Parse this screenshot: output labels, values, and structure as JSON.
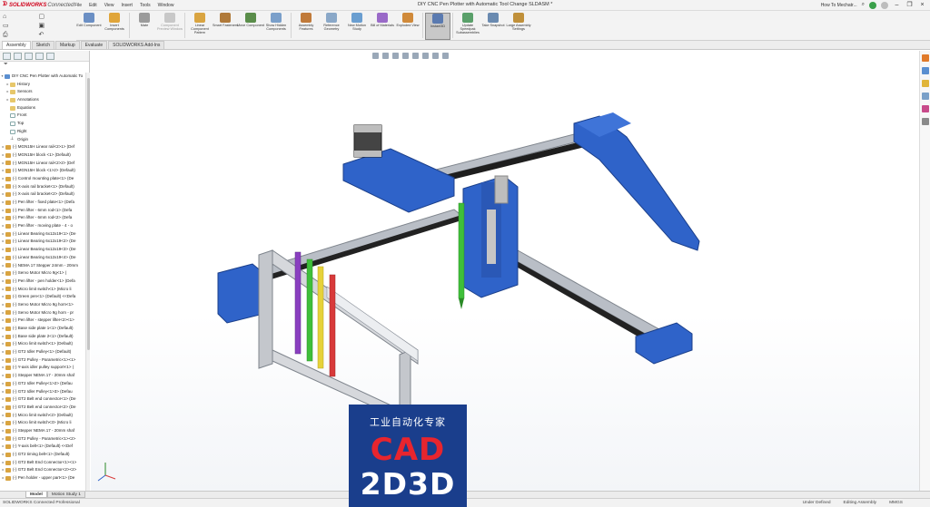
{
  "app": {
    "brand_name": "SOLIDWORKS",
    "brand_suffix": "Connected",
    "document_title": "DIY CNC Pen Plotter with Automatic Tool Change SLDASM *",
    "search_label": "How To Mechatr...",
    "menus": [
      "File",
      "Edit",
      "View",
      "Insert",
      "Tools",
      "Window"
    ]
  },
  "ribbon": {
    "buttons": [
      {
        "label": "Edit Component",
        "icon": "edit-component-icon",
        "color": "#6b8fc4",
        "enabled": true
      },
      {
        "label": "Insert Components",
        "icon": "insert-components-icon",
        "color": "#e0a53a",
        "enabled": true
      },
      {
        "label": "Mate",
        "icon": "mate-icon",
        "color": "#9b9b9b",
        "enabled": true
      },
      {
        "label": "Component Preview Window",
        "icon": "preview-window-icon",
        "color": "#c8c8c8",
        "enabled": false
      },
      {
        "label": "Linear Component Pattern",
        "icon": "linear-pattern-icon",
        "color": "#d9a441",
        "enabled": true
      },
      {
        "label": "Smart Fasteners",
        "icon": "smart-fasteners-icon",
        "color": "#b07a3a",
        "enabled": true
      },
      {
        "label": "Move Component",
        "icon": "move-component-icon",
        "color": "#5a8d4a",
        "enabled": true
      },
      {
        "label": "Show Hidden Components",
        "icon": "show-hidden-icon",
        "color": "#7a9fca",
        "enabled": true
      },
      {
        "label": "Assembly Features",
        "icon": "assembly-features-icon",
        "color": "#c07a3a",
        "enabled": true
      },
      {
        "label": "Reference Geometry",
        "icon": "reference-geometry-icon",
        "color": "#8aa8c8",
        "enabled": true
      },
      {
        "label": "New Motion Study",
        "icon": "motion-study-icon",
        "color": "#6a9ed0",
        "enabled": true
      },
      {
        "label": "Bill of Materials",
        "icon": "bill-of-materials-icon",
        "color": "#9a6ac8",
        "enabled": true
      },
      {
        "label": "Exploded View",
        "icon": "exploded-view-icon",
        "color": "#d08a3a",
        "enabled": true
      },
      {
        "label": "Instant3D",
        "icon": "instant3d-icon",
        "color": "#5a7ab0",
        "enabled": true,
        "selected": true
      },
      {
        "label": "Update Speedpak Subassemblies",
        "icon": "speedpak-icon",
        "color": "#5aa06a",
        "enabled": true
      },
      {
        "label": "Take Snapshot",
        "icon": "snapshot-icon",
        "color": "#6a8ab0",
        "enabled": true
      },
      {
        "label": "Large Assembly Settings",
        "icon": "large-assembly-icon",
        "color": "#c0903a",
        "enabled": true
      }
    ]
  },
  "command_tabs": [
    "Assembly",
    "Sketch",
    "Markup",
    "Evaluate",
    "SOLIDWORKS Add-Ins"
  ],
  "feature_tree": {
    "root": "DIY CNC Pen Plotter with Automatic To",
    "items": [
      {
        "label": "History",
        "type": "fold",
        "indent": 1
      },
      {
        "label": "Sensors",
        "type": "fold",
        "indent": 1
      },
      {
        "label": "Annotations",
        "type": "fold",
        "indent": 1
      },
      {
        "label": "Equations",
        "type": "fold",
        "indent": 1
      },
      {
        "label": "Front",
        "type": "plane",
        "indent": 1
      },
      {
        "label": "Top",
        "type": "plane",
        "indent": 1
      },
      {
        "label": "Right",
        "type": "plane",
        "indent": 1
      },
      {
        "label": "Origin",
        "type": "origin",
        "indent": 1
      },
      {
        "label": "(-) MGN15H Linear rail<2>1> (Def",
        "type": "gear",
        "indent": 0
      },
      {
        "label": "(-) MGN15H block <1> (Default)",
        "type": "gear",
        "indent": 0
      },
      {
        "label": "(-) MGN15H Linear rail<2>2> (Def",
        "type": "gear",
        "indent": 0
      },
      {
        "label": "(-) MGN15H block <1>2> (Default)",
        "type": "gear",
        "indent": 0
      },
      {
        "label": "(-) Control mounting plate<1> (De",
        "type": "gear",
        "indent": 0
      },
      {
        "label": "(-) X-axis rail bracket<1> (Default)",
        "type": "gear",
        "indent": 0
      },
      {
        "label": "(-) X-axis rail bracket<2> (Default)",
        "type": "gear",
        "indent": 0
      },
      {
        "label": "(-) Pen lifter - fixed plate<1> (Defa",
        "type": "gear",
        "indent": 0
      },
      {
        "label": "(-) Pen lifter - 6mm rod<1> (Defa",
        "type": "gear",
        "indent": 0
      },
      {
        "label": "(-) Pen lifter - 6mm rod<2> (Defa",
        "type": "gear",
        "indent": 0
      },
      {
        "label": "(-) Pen lifter - moving plate - 4 - o",
        "type": "gear",
        "indent": 0
      },
      {
        "label": "(-) Linear Bearing 6x12x19<1> (De",
        "type": "gear",
        "indent": 0
      },
      {
        "label": "(-) Linear Bearing 6x12x19<2> (De",
        "type": "gear",
        "indent": 0
      },
      {
        "label": "(-) Linear Bearing 6x12x19<3> (De",
        "type": "gear",
        "indent": 0
      },
      {
        "label": "(-) Linear Bearing 6x12x19<4> (De",
        "type": "gear",
        "indent": 0
      },
      {
        "label": "(-) NEMA 17 Stepper 24mm - 20mm",
        "type": "gear",
        "indent": 0
      },
      {
        "label": "(-) Servo Motor Micro 9g<1> (",
        "type": "gear",
        "indent": 0
      },
      {
        "label": "(-) Pen lifter - pen holder<1> (Defa",
        "type": "gear",
        "indent": 0
      },
      {
        "label": "(-) Micro limit switch<1> (Micro li",
        "type": "gear",
        "indent": 0
      },
      {
        "label": "(-) Green pen<1> (Default) <<Defa",
        "type": "gear",
        "indent": 0
      },
      {
        "label": "(-) Servo Motor Micro 9g horn<1>",
        "type": "gear",
        "indent": 0
      },
      {
        "label": "(-) Servo Motor Micro 9g horn - pr",
        "type": "gear",
        "indent": 0
      },
      {
        "label": "(-) Pen lifter - stepper lifter<2><1>",
        "type": "gear",
        "indent": 0
      },
      {
        "label": "(-) Base side plate 1<1> (Default)",
        "type": "gear",
        "indent": 0
      },
      {
        "label": "(-) Base side plate 2<1> (Default)",
        "type": "gear",
        "indent": 0
      },
      {
        "label": "(-) Micro limit switch<1> (Default)",
        "type": "gear",
        "indent": 0
      },
      {
        "label": "(-) GT2 Idler Pulley<1> (Default)",
        "type": "gear",
        "indent": 0
      },
      {
        "label": "(-) GT2 Pulley - Parametric<1><1>",
        "type": "gear",
        "indent": 0
      },
      {
        "label": "(-) Y-axis idler pulley support<1> (",
        "type": "gear",
        "indent": 0
      },
      {
        "label": "(-) Stepper NEMA 17 - 20mm shaf",
        "type": "gear",
        "indent": 0
      },
      {
        "label": "(-) GT2 Idler Pulley<1>2> (Defau",
        "type": "gear",
        "indent": 0
      },
      {
        "label": "(-) GT2 Idler Pulley<1>3> (Defau",
        "type": "gear",
        "indent": 0
      },
      {
        "label": "(-) GT2 Belt end connector<1> (De",
        "type": "gear",
        "indent": 0
      },
      {
        "label": "(-) GT2 Belt end connector<2> (De",
        "type": "gear",
        "indent": 0
      },
      {
        "label": "(-) Micro limit switch<2> (Default)",
        "type": "gear",
        "indent": 0
      },
      {
        "label": "(-) Micro limit switch<3> (Micro li",
        "type": "gear",
        "indent": 0
      },
      {
        "label": "(-) Stepper NEMA 17 - 20mm shaf",
        "type": "gear",
        "indent": 0
      },
      {
        "label": "(-) GT2 Pulley - Parametric<1><2>",
        "type": "gear",
        "indent": 0
      },
      {
        "label": "(-) Y-axis belt<1> (Default) <<Def",
        "type": "gear",
        "indent": 0
      },
      {
        "label": "(-) GT2 timing belt<1> (Default)",
        "type": "gear",
        "indent": 0
      },
      {
        "label": "(-) GT2 Belt End Connector<1><1>",
        "type": "gear",
        "indent": 0
      },
      {
        "label": "(-) GT2 Belt End Connector<2><2>",
        "type": "gear",
        "indent": 0
      },
      {
        "label": "(-) Pen holder - upper part<1> (De",
        "type": "gear",
        "indent": 0
      }
    ]
  },
  "bottom_tabs": [
    "Model",
    "Motion Study 1"
  ],
  "status": {
    "left": "SOLIDWORKS Connected Professional",
    "under_defined": "Under Defined",
    "editing": "Editing Assembly",
    "units": "MMGS"
  },
  "watermark": {
    "line1": "工业自动化专家",
    "line2": "CAD",
    "line3": "2D3D"
  },
  "colors": {
    "part_blue": "#2f63c9",
    "rail_grey": "#b9bec6",
    "pen_green": "#3fbf3a",
    "pen_purple": "#8a3fc0",
    "pen_yellow": "#e6d23a",
    "pen_red": "#d83a3a",
    "watermark_bg": "#1a3e8c"
  }
}
